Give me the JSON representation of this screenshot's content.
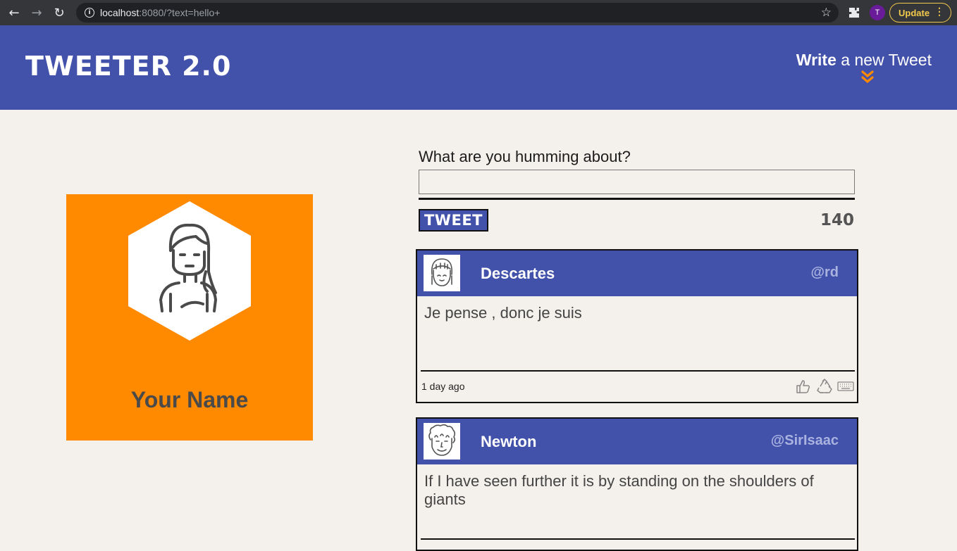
{
  "browser": {
    "url_host": "localhost",
    "url_rest": ":8080/?text=hello+",
    "profile_initial": "T",
    "update_label": "Update"
  },
  "header": {
    "logo": "TWEETER 2.0",
    "write_bold": "Write",
    "write_rest": "a new Tweet"
  },
  "profile": {
    "name": "Your Name"
  },
  "compose": {
    "label": "What are you humming about?",
    "value": "",
    "button": "TWEET",
    "counter": "140"
  },
  "tweets": [
    {
      "name": "Descartes",
      "handle": "@rd",
      "text": "Je pense , donc je suis",
      "time": "1 day ago"
    },
    {
      "name": "Newton",
      "handle": "@SirIsaac",
      "text": "If I have seen further it is by standing on the shoulders of giants"
    }
  ],
  "colors": {
    "header_bg": "#4251aa",
    "page_bg": "#f4f1ec",
    "profile_bg": "#ff8a00",
    "chevron": "#ff8a00"
  },
  "icons": [
    "back-icon",
    "forward-icon",
    "reload-icon",
    "info-icon",
    "star-icon",
    "extensions-icon",
    "kebab-menu-icon",
    "chevron-down-icon",
    "like-icon",
    "retweet-icon",
    "reply-keyboard-icon"
  ]
}
